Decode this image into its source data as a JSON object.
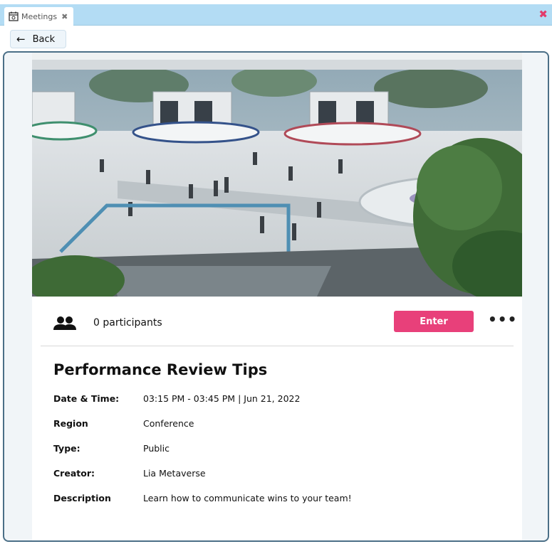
{
  "window": {
    "tab_label": "Meetings",
    "tab_icon": "calendar-icon",
    "close_icon": "close-icon",
    "accent_color": "#b3dcf4",
    "close_color": "#e23b6b"
  },
  "nav": {
    "back_label": "Back"
  },
  "meeting": {
    "participants": "0 participants",
    "enter_label": "Enter",
    "enter_color": "#e8407a",
    "title": "Performance Review Tips",
    "details": [
      {
        "label": "Date & Time:",
        "value": "03:15 PM - 03:45 PM | Jun 21, 2022"
      },
      {
        "label": "Region",
        "value": "Conference"
      },
      {
        "label": "Type:",
        "value": "Public"
      },
      {
        "label": "Creator:",
        "value": "Lia Metaverse"
      },
      {
        "label": "Description",
        "value": "Learn how to communicate wins to your team!"
      }
    ]
  }
}
